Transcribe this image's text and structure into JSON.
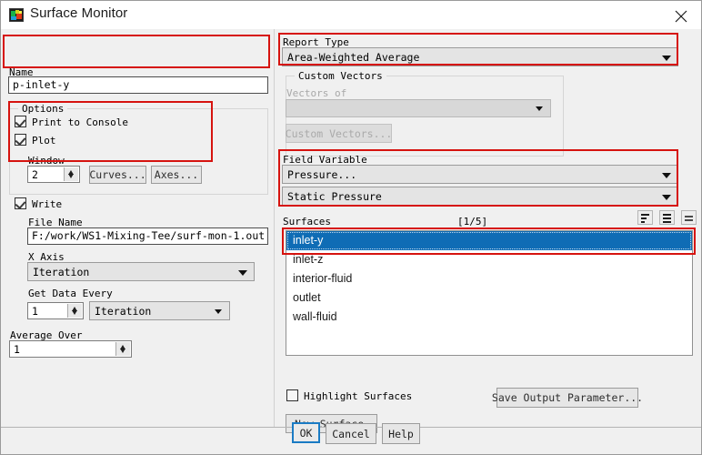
{
  "window": {
    "title": "Surface Monitor",
    "icon": "fluent-app-icon",
    "close_icon": "close-icon"
  },
  "left": {
    "name_label": "Name",
    "name_value": "p-inlet-y",
    "options_group": "Options",
    "print_to_console": "Print to Console",
    "print_to_console_checked": true,
    "plot": "Plot",
    "plot_checked": true,
    "window_label": "Window",
    "window_value": "2",
    "curves_button": "Curves...",
    "axes_button": "Axes...",
    "write": "Write",
    "write_checked": true,
    "file_name_label": "File Name",
    "file_name_value": "F:/work/WS1-Mixing-Tee/surf-mon-1.out",
    "x_axis_label": "X Axis",
    "x_axis_value": "Iteration",
    "get_data_every_label": "Get Data Every",
    "get_data_every_value": "1",
    "get_data_every_unit": "Iteration",
    "average_over_label": "Average Over",
    "average_over_value": "1"
  },
  "right": {
    "report_type_label": "Report Type",
    "report_type_value": "Area-Weighted Average",
    "custom_vectors_group": "Custom Vectors",
    "vectors_of_label": "Vectors of",
    "vectors_of_value": "",
    "custom_vectors_button": "Custom Vectors...",
    "field_variable_label": "Field Variable",
    "field_variable_value": "Pressure...",
    "field_variable_sub_value": "Static Pressure",
    "surfaces_label": "Surfaces",
    "surfaces_count": "[1/5]",
    "toolbar_icons": [
      "filter-list-icon",
      "list-all-icon",
      "deselect-all-icon"
    ],
    "surfaces": [
      {
        "label": "inlet-y",
        "selected": true
      },
      {
        "label": "inlet-z",
        "selected": false
      },
      {
        "label": "interior-fluid",
        "selected": false
      },
      {
        "label": "outlet",
        "selected": false
      },
      {
        "label": "wall-fluid",
        "selected": false
      }
    ],
    "highlight_surfaces": "Highlight Surfaces",
    "highlight_surfaces_checked": false,
    "save_output_parameter_button": "Save Output Parameter...",
    "new_surface_button": "New Surface"
  },
  "footer": {
    "ok": "OK",
    "cancel": "Cancel",
    "help": "Help"
  },
  "colors": {
    "selection_blue": "#0f6cb5",
    "annotation_red": "#d6130f",
    "focus_blue": "#1a7bc4",
    "dialog_bg": "#f0f0f0"
  }
}
